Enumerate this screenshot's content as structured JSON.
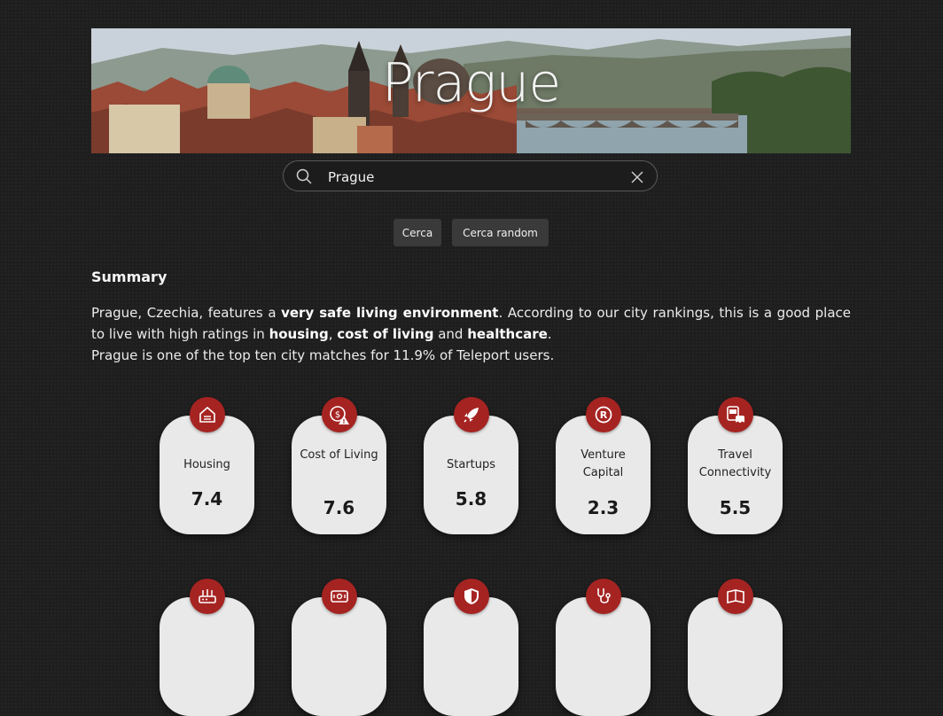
{
  "hero": {
    "title": "Prague"
  },
  "search": {
    "value": "Prague"
  },
  "buttons": {
    "search": "Cerca",
    "random": "Cerca random"
  },
  "summary": {
    "title": "Summary",
    "line1_a": "Prague, Czechia, features a ",
    "line1_b": "very safe living environment",
    "line1_c": ". According to our city rankings, this is a good place to live with high ratings in ",
    "line2_b1": "housing",
    "line2_sep1": ", ",
    "line2_b2": "cost of living",
    "line2_sep2": " and ",
    "line2_b3": "healthcare",
    "line2_end": ".",
    "line3": "Prague is one of the top ten city matches for 11.9% of Teleport users."
  },
  "cards": [
    {
      "label": "Housing",
      "value": "7.4",
      "icon": "house-icon"
    },
    {
      "label": "Cost of Living",
      "value": "7.6",
      "icon": "cost-of-living-icon"
    },
    {
      "label": "Startups",
      "value": "5.8",
      "icon": "rocket-icon"
    },
    {
      "label": "Venture Capital",
      "value": "2.3",
      "icon": "registered-icon"
    },
    {
      "label": "Travel Connectivity",
      "value": "5.5",
      "icon": "transit-icon"
    }
  ],
  "cards_row2_icons": [
    "router-icon",
    "money-icon",
    "shield-icon",
    "stethoscope-icon",
    "book-icon"
  ],
  "colors": {
    "accent": "#a52422",
    "card": "#e9e9e9",
    "background": "#1e1e1e"
  }
}
